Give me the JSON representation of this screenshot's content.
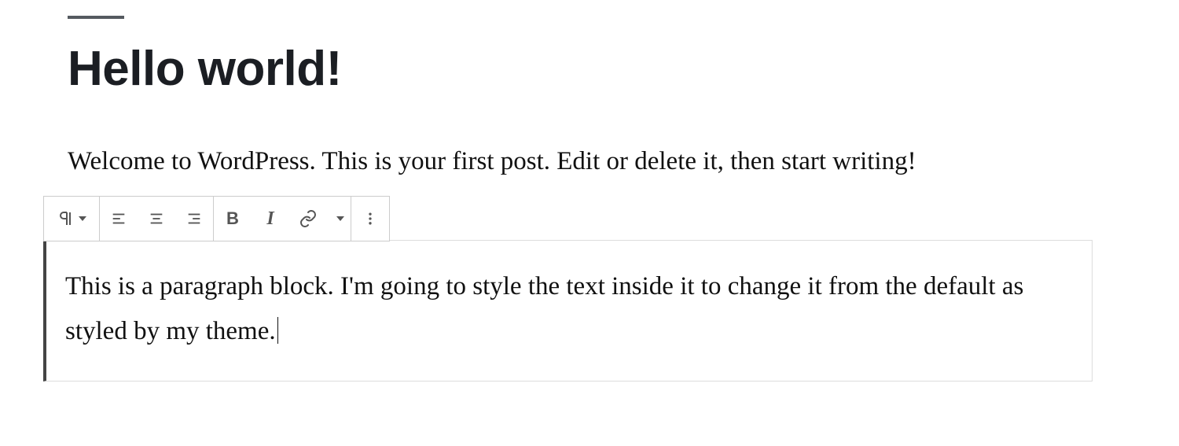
{
  "post": {
    "title": "Hello world!",
    "intro": "Welcome to WordPress. This is your first post. Edit or delete it, then start writing!",
    "paragraph": "This is a paragraph block. I'm going to style the text inside it to change it from the default as styled by my theme."
  },
  "toolbar": {
    "block_type": "paragraph",
    "align_left": "align-left",
    "align_center": "align-center",
    "align_right": "align-right",
    "bold": "B",
    "italic": "I",
    "link": "link",
    "more": "more"
  }
}
